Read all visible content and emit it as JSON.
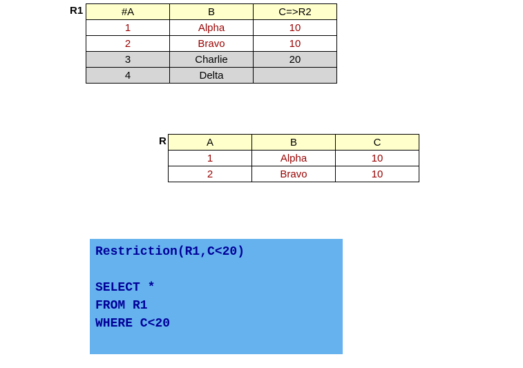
{
  "table1": {
    "label": "R1",
    "headers": [
      "#A",
      "B",
      "C=>R2"
    ],
    "rows": [
      {
        "a": "1",
        "b": "Alpha",
        "c": "10",
        "hl": false,
        "red": true
      },
      {
        "a": "2",
        "b": "Bravo",
        "c": "10",
        "hl": false,
        "red": true
      },
      {
        "a": "3",
        "b": "Charlie",
        "c": "20",
        "hl": true,
        "red": false
      },
      {
        "a": "4",
        "b": "Delta",
        "c": "",
        "hl": true,
        "red": false
      }
    ]
  },
  "table2": {
    "label": "R",
    "headers": [
      "A",
      "B",
      "C"
    ],
    "rows": [
      {
        "a": "1",
        "b": "Alpha",
        "c": "10",
        "red": true
      },
      {
        "a": "2",
        "b": "Bravo",
        "c": "10",
        "red": true
      }
    ]
  },
  "code": {
    "line1": "Restriction(R1,C<20)",
    "line2": "SELECT *",
    "line3": "FROM R1",
    "line4": "WHERE C<20"
  }
}
